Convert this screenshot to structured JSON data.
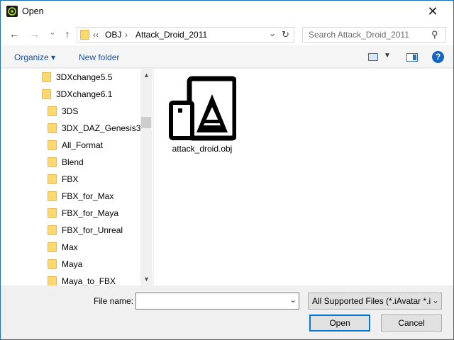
{
  "window": {
    "title": "Open",
    "close_glyph": "✕"
  },
  "nav": {
    "back_glyph": "←",
    "forward_glyph": "→",
    "recent_glyph": "⌄",
    "up_glyph": "↑",
    "overflow_glyph": "‹‹",
    "breadcrumbs": [
      "OBJ",
      "Attack_Droid_2011"
    ],
    "separator": "›",
    "dropdown_glyph": "⌄",
    "refresh_glyph": "↻",
    "search_placeholder": "Search Attack_Droid_2011",
    "search_glyph": "⚲"
  },
  "toolbar": {
    "organize_label": "Organize ▾",
    "new_folder_label": "New folder",
    "help_glyph": "?"
  },
  "tree": {
    "items": [
      {
        "label": "3DXchange5.5",
        "indent": 1
      },
      {
        "label": "3DXchange6.1",
        "indent": 1
      },
      {
        "label": "3DS",
        "indent": 2
      },
      {
        "label": "3DX_DAZ_Genesis3",
        "indent": 2
      },
      {
        "label": "All_Format",
        "indent": 2
      },
      {
        "label": "Blend",
        "indent": 2
      },
      {
        "label": "FBX",
        "indent": 2
      },
      {
        "label": "FBX_for_Max",
        "indent": 2
      },
      {
        "label": "FBX_for_Maya",
        "indent": 2
      },
      {
        "label": "FBX_for_Unreal",
        "indent": 2
      },
      {
        "label": "Max",
        "indent": 2
      },
      {
        "label": "Maya",
        "indent": 2
      },
      {
        "label": "Maya_to_FBX",
        "indent": 2
      }
    ]
  },
  "files": [
    {
      "name": "attack_droid.obj",
      "icon": "iclone-file-icon"
    }
  ],
  "bottom": {
    "filename_label": "File name:",
    "filename_value": "",
    "filter_value": "All Supported Files (*.iAvatar *.i",
    "open_label": "Open",
    "cancel_label": "Cancel"
  },
  "colors": {
    "accent": "#0078d7",
    "folder": "#ffd86e",
    "link": "#1a4fa8"
  }
}
